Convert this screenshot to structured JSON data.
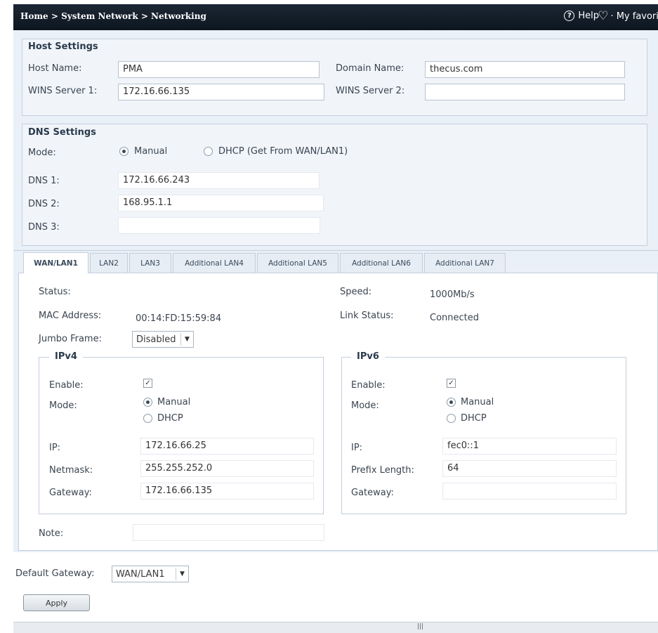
{
  "header": {
    "breadcrumb": "Home > System Network > Networking",
    "help_label": "Help",
    "favorite_label": "My favorit"
  },
  "host_settings": {
    "legend": "Host Settings",
    "host_name_label": "Host Name:",
    "host_name_value": "PMA",
    "domain_name_label": "Domain Name:",
    "domain_name_value": "thecus.com",
    "wins1_label": "WINS Server 1:",
    "wins1_value": "172.16.66.135",
    "wins2_label": "WINS Server 2:",
    "wins2_value": ""
  },
  "dns_settings": {
    "legend": "DNS Settings",
    "mode_label": "Mode:",
    "mode_options": [
      "Manual",
      "DHCP (Get From WAN/LAN1)"
    ],
    "mode_selected": "Manual",
    "dns1_label": "DNS 1:",
    "dns1_value": "172.16.66.243",
    "dns2_label": "DNS 2:",
    "dns2_value": "168.95.1.1",
    "dns3_label": "DNS 3:",
    "dns3_value": ""
  },
  "tabs": [
    {
      "label": "WAN/LAN1",
      "active": true
    },
    {
      "label": "LAN2"
    },
    {
      "label": "LAN3"
    },
    {
      "label": "Additional LAN4"
    },
    {
      "label": "Additional LAN5"
    },
    {
      "label": "Additional LAN6"
    },
    {
      "label": "Additional LAN7"
    }
  ],
  "interface": {
    "status_label": "Status:",
    "status_value": "",
    "mac_label": "MAC Address:",
    "mac_value": "00:14:FD:15:59:84",
    "jumbo_label": "Jumbo Frame:",
    "jumbo_value": "Disabled",
    "speed_label": "Speed:",
    "speed_value": "1000Mb/s",
    "link_label": "Link Status:",
    "link_value": "Connected",
    "note_label": "Note:",
    "note_value": ""
  },
  "ipv4": {
    "legend": "IPv4",
    "enable_label": "Enable:",
    "enabled": true,
    "mode_label": "Mode:",
    "mode_options": [
      "Manual",
      "DHCP"
    ],
    "mode_selected": "Manual",
    "ip_label": "IP:",
    "ip_value": "172.16.66.25",
    "netmask_label": "Netmask:",
    "netmask_value": "255.255.252.0",
    "gateway_label": "Gateway:",
    "gateway_value": "172.16.66.135"
  },
  "ipv6": {
    "legend": "IPv6",
    "enable_label": "Enable:",
    "enabled": true,
    "mode_label": "Mode:",
    "mode_options": [
      "Manual",
      "DHCP"
    ],
    "mode_selected": "Manual",
    "ip_label": "IP:",
    "ip_value": "fec0::1",
    "prefix_label": "Prefix Length:",
    "prefix_value": "64",
    "gateway_label": "Gateway:",
    "gateway_value": ""
  },
  "footer": {
    "default_gateway_label": "Default Gateway:",
    "default_gateway_value": "WAN/LAN1",
    "apply_label": "Apply"
  },
  "icons": {
    "help": "help-circle-icon",
    "favorite": "heart-icon",
    "dropdown": "chevron-down-icon",
    "check": "checkmark-icon"
  }
}
